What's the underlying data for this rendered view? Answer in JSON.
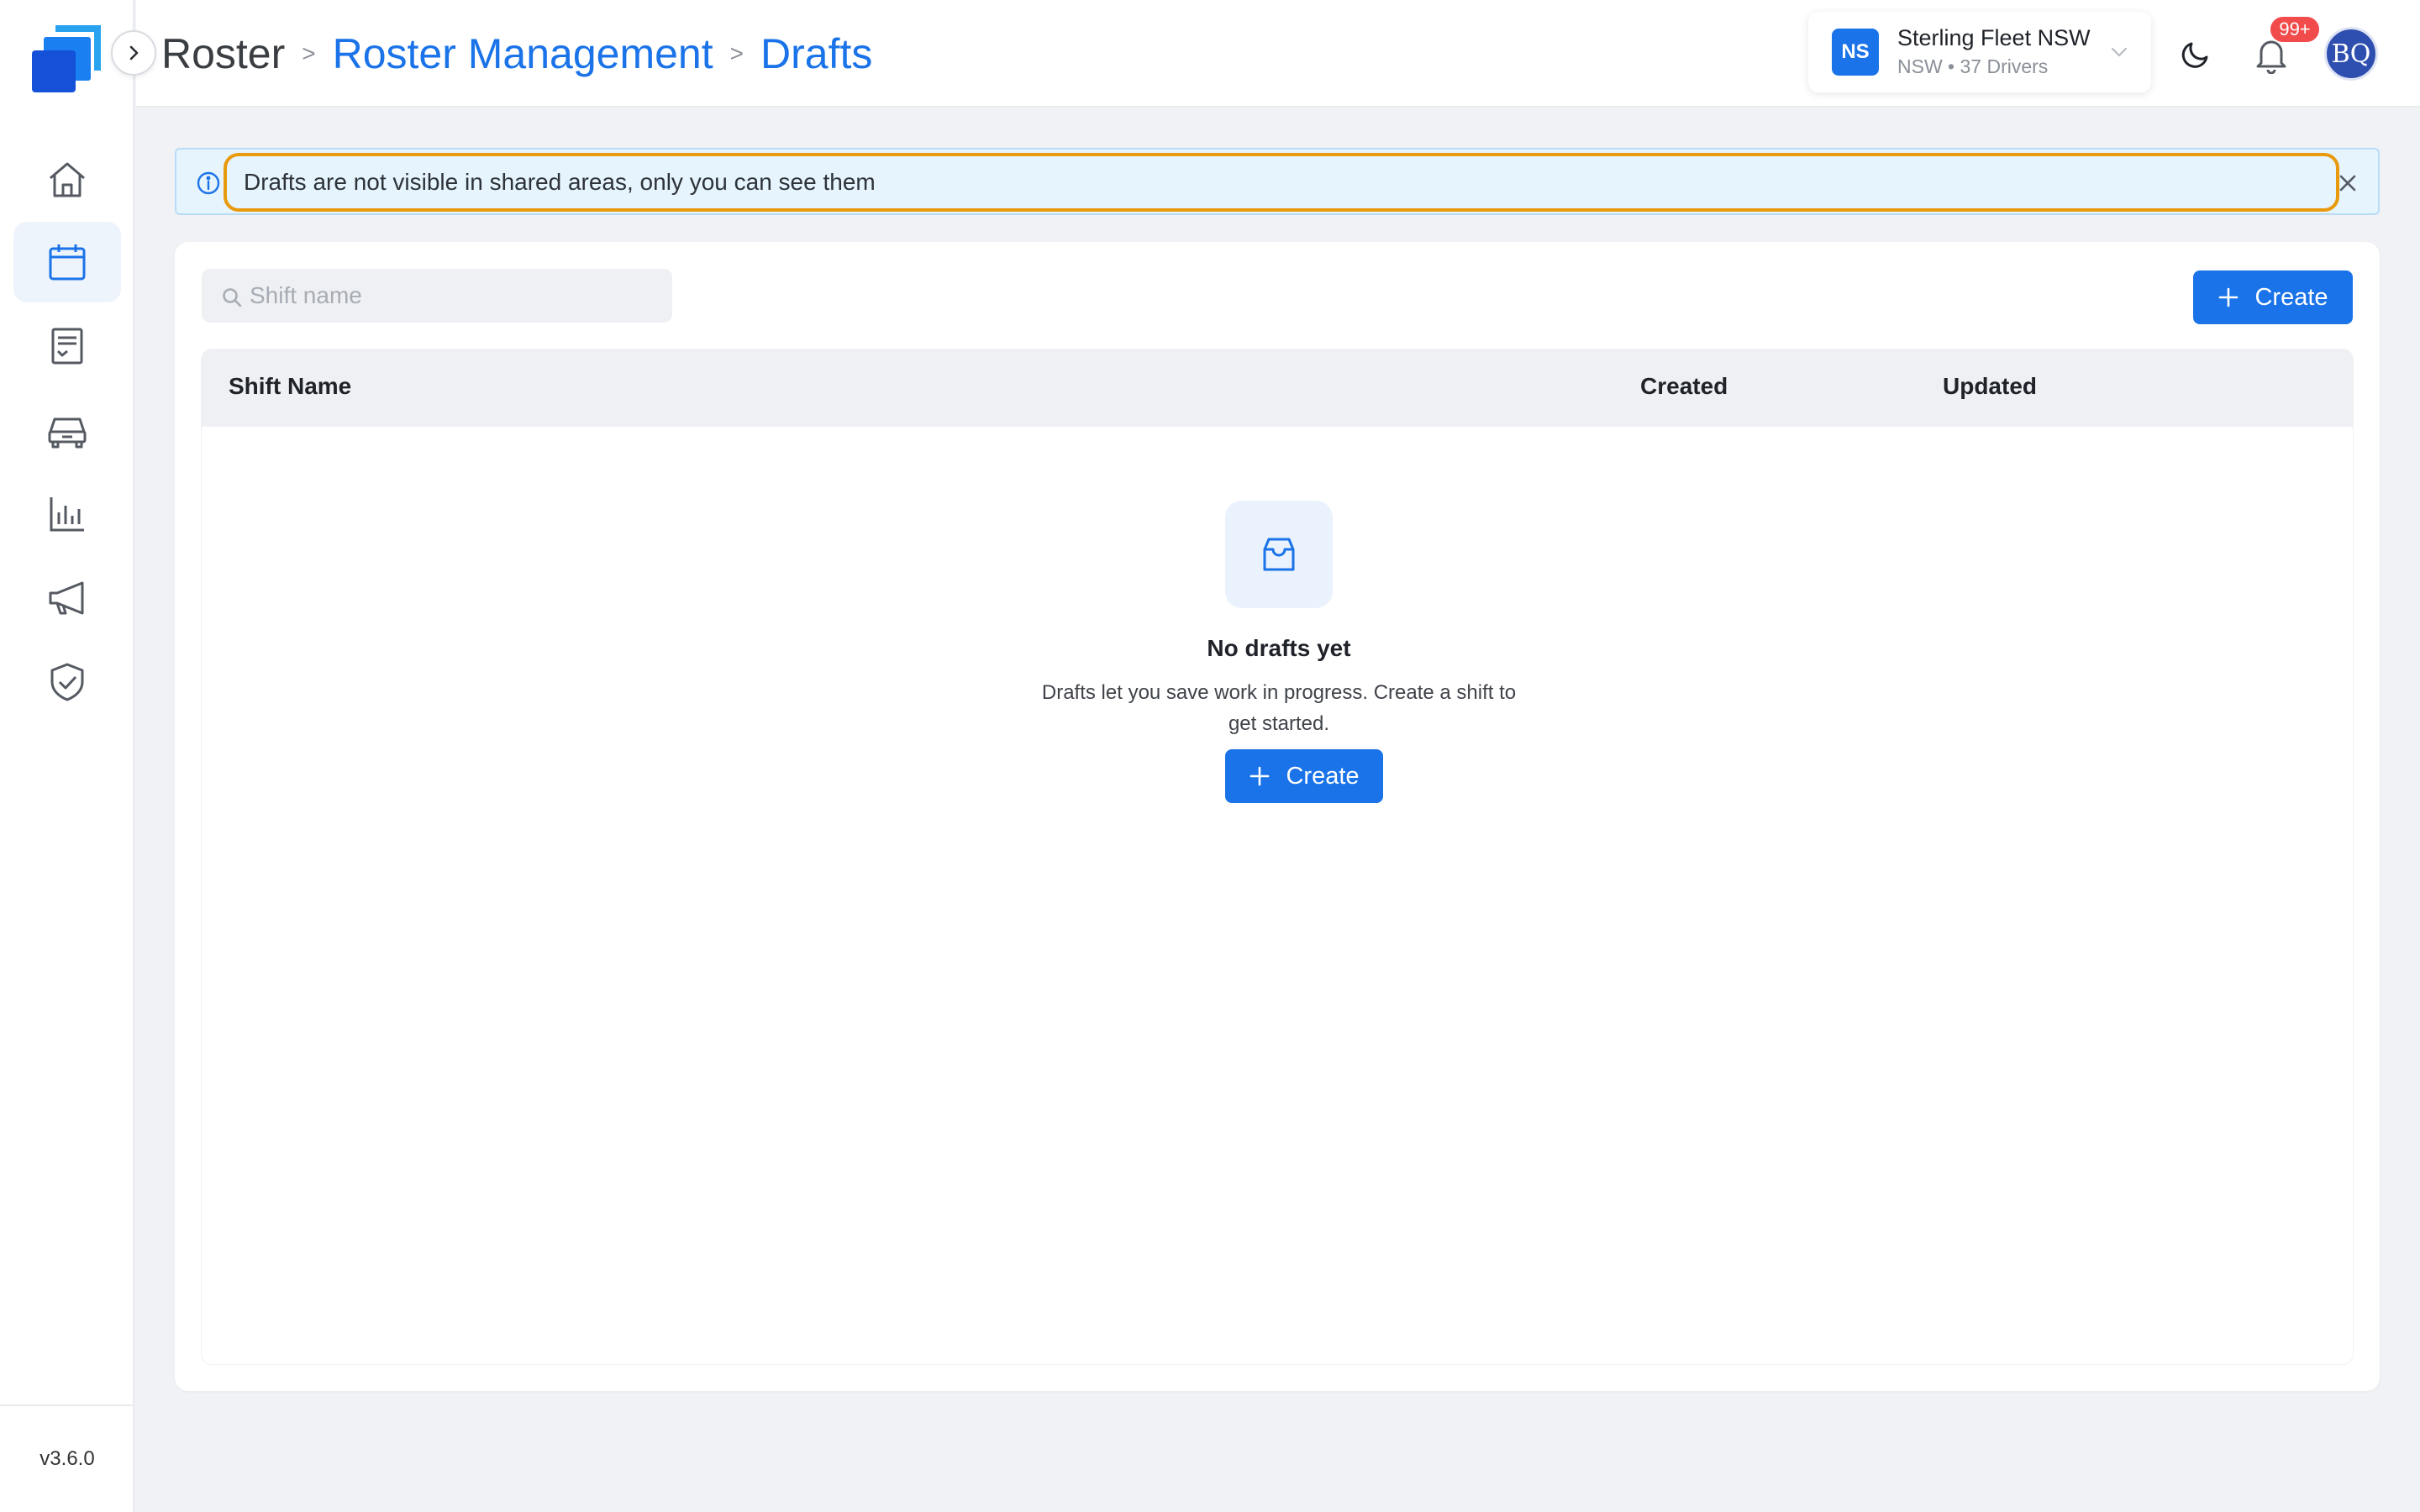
{
  "app": {
    "version": "v3.6.0"
  },
  "breadcrumb": {
    "root": "Roster",
    "section": "Roster Management",
    "current": "Drafts",
    "separator": ">"
  },
  "sidebar": {
    "items": [
      {
        "name": "home",
        "icon": "home-icon"
      },
      {
        "name": "roster",
        "icon": "calendar-icon",
        "active": true
      },
      {
        "name": "documents",
        "icon": "document-icon"
      },
      {
        "name": "vehicles",
        "icon": "car-icon"
      },
      {
        "name": "reports",
        "icon": "bar-chart-icon"
      },
      {
        "name": "announcements",
        "icon": "megaphone-icon"
      },
      {
        "name": "compliance",
        "icon": "shield-check-icon"
      }
    ]
  },
  "org": {
    "initials": "NS",
    "name": "Sterling Fleet NSW",
    "subtitle": "NSW • 37 Drivers"
  },
  "notifications": {
    "count": "99+"
  },
  "user": {
    "initials": "BQ"
  },
  "banner": {
    "text": "Drafts are not visible in shared areas, only you can see them"
  },
  "toolbar": {
    "search_placeholder": "Shift name",
    "create_label": "Create"
  },
  "table": {
    "columns": [
      "Shift Name",
      "Created",
      "Updated"
    ]
  },
  "empty_state": {
    "title": "No drafts yet",
    "description": "Drafts let you save work in progress. Create a shift to get started.",
    "button_label": "Create"
  },
  "colors": {
    "accent": "#1a73e8",
    "badge": "#f24b4b",
    "highlight": "#e89a0c"
  }
}
